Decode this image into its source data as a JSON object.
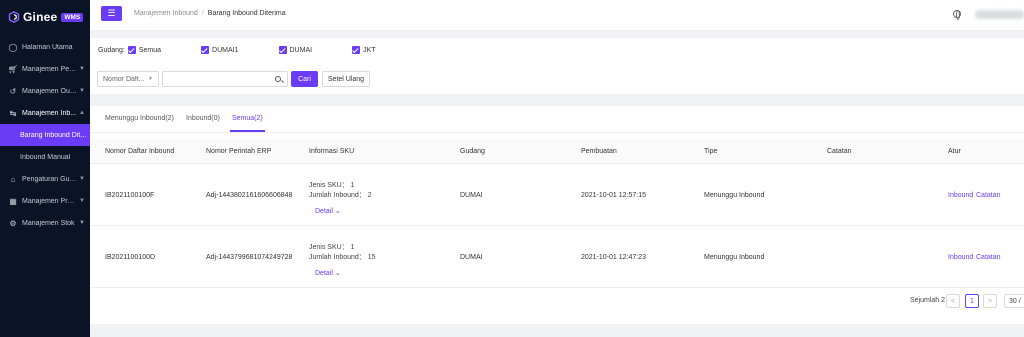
{
  "sidebar": {
    "logo_text": "Ginee",
    "logo_badge": "WMS",
    "items": [
      {
        "icon": "dashboard-icon",
        "label": "Halaman Utama"
      },
      {
        "icon": "cart-icon",
        "label": "Manajemen Pes..."
      },
      {
        "icon": "outbound-icon",
        "label": "Manajemen Out..."
      },
      {
        "icon": "inbound-icon",
        "label": "Manajemen Inb..."
      },
      {
        "icon": "warehouse-settings-icon",
        "label": "Pengaturan Gud..."
      },
      {
        "icon": "product-icon",
        "label": "Manajemen Pro..."
      },
      {
        "icon": "stock-icon",
        "label": "Manajemen Stok"
      }
    ],
    "sub_items": [
      {
        "label": "Barang Inbound Dit..."
      },
      {
        "label": "Inbound Manual"
      }
    ]
  },
  "topbar": {
    "breadcrumb_parent": "Manajemen Inbound",
    "breadcrumb_separator": "/",
    "breadcrumb_current": "Barang Inbound Diterima"
  },
  "filters": {
    "gudang_label": "Gudang:",
    "options": [
      "Semua",
      "DUMAI1",
      "DUMAI",
      "JKT"
    ],
    "select_value": "Nomor Daft...",
    "search_placeholder": "",
    "search_button": "Cari",
    "reset_button": "Setel Ulang"
  },
  "tabs": [
    {
      "label": "Menunggu Inbound(2)",
      "active": false
    },
    {
      "label": "Inbound(0)",
      "active": false
    },
    {
      "label": "Semua(2)",
      "active": true
    }
  ],
  "table": {
    "columns": [
      "Nomor Daftar Inbound",
      "Nomor Perintah ERP",
      "Informasi SKU",
      "Gudang",
      "Pembuatan",
      "Tipe",
      "Catatan",
      "Atur"
    ],
    "rows": [
      {
        "list_no": "IB2021100100F",
        "erp_no": "Adj-1443802161606606848",
        "sku_types": "Jenis SKU： 1",
        "inbound_qty": "Jumlah Inbound： 2",
        "detail": "Detail",
        "warehouse": "DUMAI",
        "created": "2021-10-01 12:57:15",
        "type": "Menunggu Inbound",
        "note": "",
        "action_inbound": "Inbound",
        "action_note": "Catatan"
      },
      {
        "list_no": "IB2021100100D",
        "erp_no": "Adj-1443799681074249728",
        "sku_types": "Jenis SKU： 1",
        "inbound_qty": "Jumlah Inbound： 15",
        "detail": "Detail",
        "warehouse": "DUMAI",
        "created": "2021-10-01 12:47:23",
        "type": "Menunggu Inbound",
        "note": "",
        "action_inbound": "Inbound",
        "action_note": "Catatan"
      }
    ]
  },
  "pagination": {
    "total_label": "Sejumlah 2",
    "prev": "<",
    "current_page": "1",
    "next": ">",
    "page_size": "30 /"
  },
  "colors": {
    "accent": "#6a3cf5",
    "sidebar_bg": "#0b1427"
  }
}
